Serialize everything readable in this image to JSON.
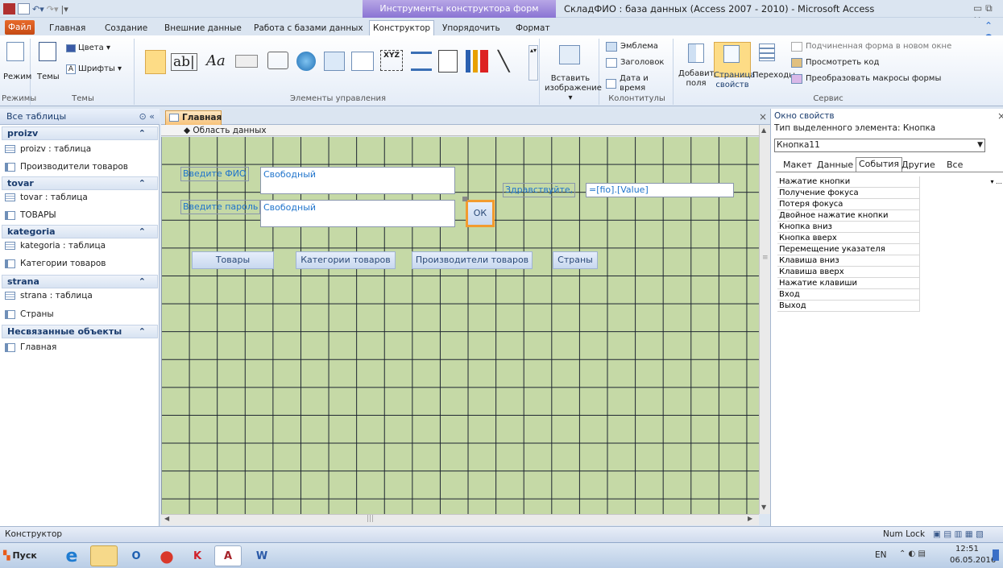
{
  "window": {
    "title": "СкладФИО : база данных (Access 2007 - 2010)  -  Microsoft Access",
    "context_band": "Инструменты конструктора форм"
  },
  "ribbon": {
    "file_tab": "Файл",
    "tabs": [
      "Главная",
      "Создание",
      "Внешние данные",
      "Работа с базами данных",
      "Конструктор",
      "Упорядочить",
      "Формат"
    ],
    "groups": {
      "modes": {
        "label": "Режимы",
        "view": "Режим"
      },
      "themes": {
        "label": "Темы",
        "themes": "Темы",
        "colors": "Цвета ▾",
        "fonts": "Шрифты ▾"
      },
      "controls": {
        "label": "Элементы управления"
      },
      "insert_image": "Вставить изображение ▾",
      "header_footer": {
        "label": "Колонтитулы",
        "logo": "Эмблема",
        "title": "Заголовок",
        "datetime": "Дата и время"
      },
      "tools": {
        "label": "Сервис",
        "add_fields": "Добавить поля",
        "property_sheet": "Страница свойств",
        "tab_order": "Переходы",
        "subform": "Подчиненная форма в новом окне",
        "view_code": "Просмотреть код",
        "convert_macros": "Преобразовать макросы формы"
      }
    }
  },
  "nav": {
    "header": "Все таблицы",
    "groups": [
      {
        "title": "proizv",
        "items": [
          {
            "label": "proizv : таблица",
            "type": "table"
          },
          {
            "label": "Производители товаров",
            "type": "form"
          }
        ]
      },
      {
        "title": "tovar",
        "items": [
          {
            "label": "tovar : таблица",
            "type": "table"
          },
          {
            "label": "ТОВАРЫ",
            "type": "form"
          }
        ]
      },
      {
        "title": "kategoria",
        "items": [
          {
            "label": "kategoria : таблица",
            "type": "table"
          },
          {
            "label": "Категории товаров",
            "type": "form"
          }
        ]
      },
      {
        "title": "strana",
        "items": [
          {
            "label": "strana : таблица",
            "type": "table"
          },
          {
            "label": "Страны",
            "type": "form"
          }
        ]
      },
      {
        "title": "Несвязанные объекты",
        "items": [
          {
            "label": "Главная",
            "type": "form"
          }
        ]
      }
    ]
  },
  "document": {
    "tab": "Главная",
    "section": "Область данных",
    "controls": {
      "fio_label": "Введите ФИО",
      "fio_text": "Свободный",
      "pass_label": "Введите пароль",
      "pass_text": "Свободный",
      "ok": "ОК",
      "hello_label": "Здравствуйте,",
      "hello_expr": "=[fio].[Value]",
      "btn_goods": "Товары",
      "btn_categories": "Категории товаров",
      "btn_producers": "Производители товаров",
      "btn_countries": "Страны"
    }
  },
  "props": {
    "title": "Окно свойств",
    "selection_type": "Тип выделенного элемента:  Кнопка",
    "selected": "Кнопка11",
    "tabs": [
      "Макет",
      "Данные",
      "События",
      "Другие",
      "Все"
    ],
    "active_tab": "События",
    "rows": [
      "Нажатие кнопки",
      "Получение фокуса",
      "Потеря фокуса",
      "Двойное нажатие кнопки",
      "Кнопка вниз",
      "Кнопка вверх",
      "Перемещение указателя",
      "Клавиша вниз",
      "Клавиша вверх",
      "Нажатие клавиши",
      "Вход",
      "Выход"
    ]
  },
  "status": {
    "left": "Конструктор",
    "numlock": "Num Lock"
  },
  "taskbar": {
    "start": "Пуск",
    "lang": "EN",
    "time": "12:51",
    "date": "06.05.2016"
  }
}
